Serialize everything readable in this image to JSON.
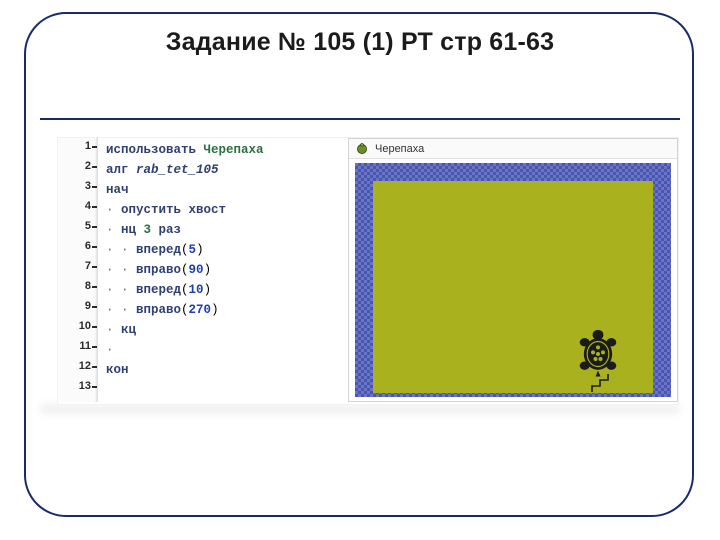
{
  "title": "Задание № 105 (1) РТ стр 61-63",
  "canvas": {
    "label": "Черепаха"
  },
  "code": {
    "lines": [
      {
        "n": "1",
        "parts": [
          {
            "cls": "kw",
            "t": "использовать "
          },
          {
            "cls": "name",
            "t": "Черепаха"
          }
        ]
      },
      {
        "n": "2",
        "parts": [
          {
            "cls": "kw",
            "t": "алг "
          },
          {
            "cls": "kw it",
            "t": "rab_tet_105"
          }
        ]
      },
      {
        "n": "3",
        "parts": [
          {
            "cls": "kw",
            "t": "нач"
          }
        ]
      },
      {
        "n": "4",
        "parts": [
          {
            "cls": "dots",
            "t": "· "
          },
          {
            "cls": "kw",
            "t": "опустить хвост"
          }
        ]
      },
      {
        "n": "5",
        "parts": [
          {
            "cls": "dots",
            "t": "· "
          },
          {
            "cls": "kw",
            "t": "нц "
          },
          {
            "cls": "name",
            "t": "3"
          },
          {
            "cls": "kw",
            "t": " раз"
          }
        ]
      },
      {
        "n": "6",
        "parts": [
          {
            "cls": "dots",
            "t": "· · "
          },
          {
            "cls": "kw",
            "t": "вперед"
          },
          {
            "cls": "",
            "t": "("
          },
          {
            "cls": "lit",
            "t": "5"
          },
          {
            "cls": "",
            "t": ")"
          }
        ]
      },
      {
        "n": "7",
        "parts": [
          {
            "cls": "dots",
            "t": "· · "
          },
          {
            "cls": "kw",
            "t": "вправо"
          },
          {
            "cls": "",
            "t": "("
          },
          {
            "cls": "lit",
            "t": "90"
          },
          {
            "cls": "",
            "t": ")"
          }
        ]
      },
      {
        "n": "8",
        "parts": [
          {
            "cls": "dots",
            "t": "· · "
          },
          {
            "cls": "kw",
            "t": "вперед"
          },
          {
            "cls": "",
            "t": "("
          },
          {
            "cls": "lit",
            "t": "10"
          },
          {
            "cls": "",
            "t": ")"
          }
        ]
      },
      {
        "n": "9",
        "parts": [
          {
            "cls": "dots",
            "t": "· · "
          },
          {
            "cls": "kw",
            "t": "вправо"
          },
          {
            "cls": "",
            "t": "("
          },
          {
            "cls": "lit",
            "t": "270"
          },
          {
            "cls": "",
            "t": ")"
          }
        ]
      },
      {
        "n": "10",
        "parts": [
          {
            "cls": "dots",
            "t": "· "
          },
          {
            "cls": "kw",
            "t": "кц"
          }
        ]
      },
      {
        "n": "11",
        "parts": [
          {
            "cls": "dots",
            "t": "·"
          }
        ]
      },
      {
        "n": "12",
        "parts": [
          {
            "cls": "kw",
            "t": "кон"
          }
        ]
      },
      {
        "n": "13",
        "parts": [
          {
            "cls": "",
            "t": ""
          }
        ]
      }
    ]
  }
}
